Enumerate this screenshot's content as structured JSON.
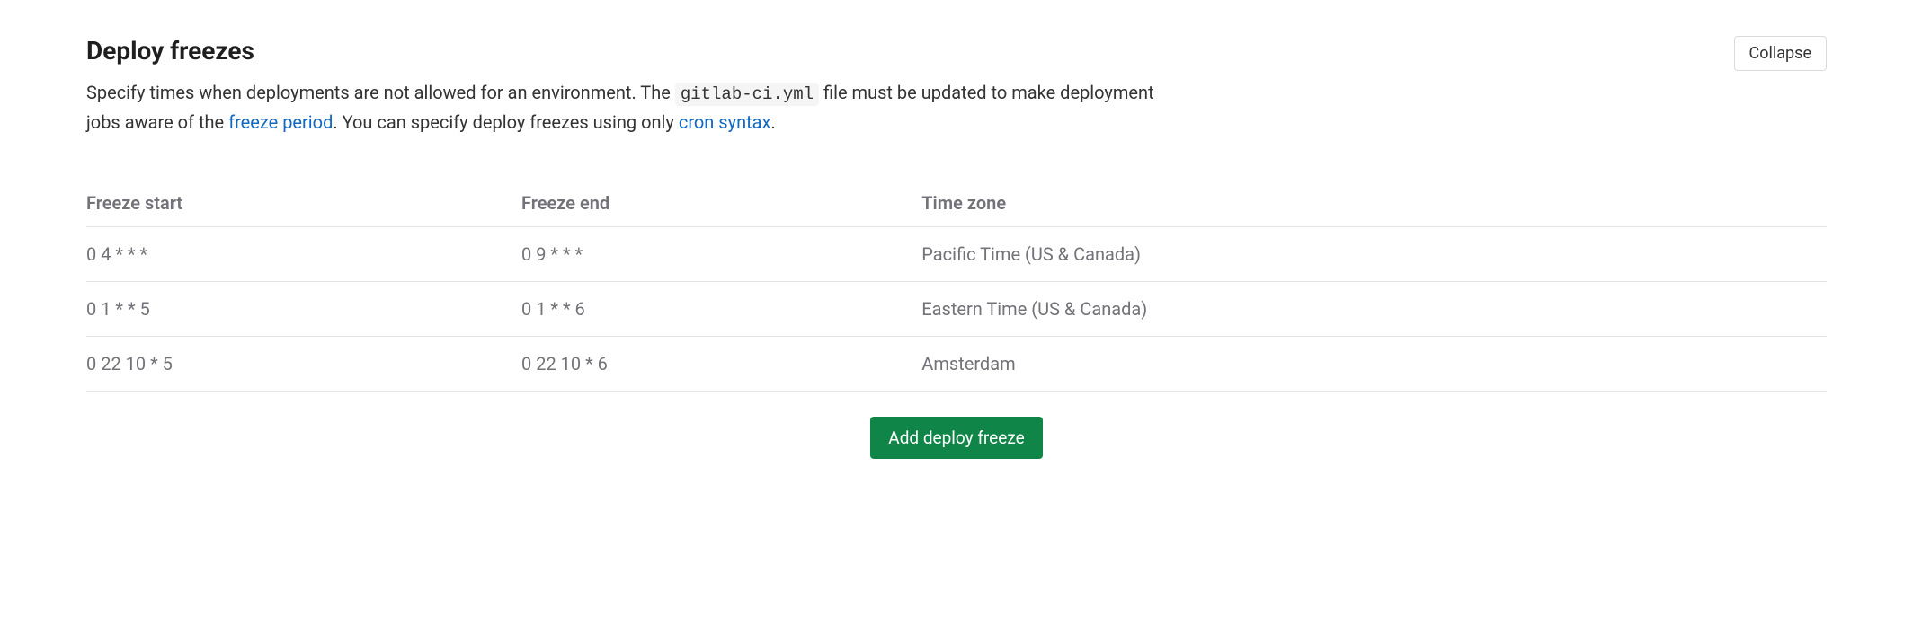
{
  "section": {
    "title": "Deploy freezes",
    "collapse_label": "Collapse"
  },
  "description": {
    "part1": "Specify times when deployments are not allowed for an environment. The ",
    "code": "gitlab-ci.yml",
    "part2": " file must be updated to make deployment jobs aware of the ",
    "link1": "freeze period",
    "part3": ". You can specify deploy freezes using only ",
    "link2": "cron syntax",
    "part4": "."
  },
  "table": {
    "headers": {
      "start": "Freeze start",
      "end": "Freeze end",
      "tz": "Time zone"
    },
    "rows": [
      {
        "start": "0 4 * * *",
        "end": "0 9 * * *",
        "tz": "Pacific Time (US & Canada)"
      },
      {
        "start": "0 1 * * 5",
        "end": "0 1 * * 6",
        "tz": "Eastern Time (US & Canada)"
      },
      {
        "start": "0 22 10 * 5",
        "end": "0 22 10 * 6",
        "tz": "Amsterdam"
      }
    ]
  },
  "actions": {
    "add_label": "Add deploy freeze"
  }
}
